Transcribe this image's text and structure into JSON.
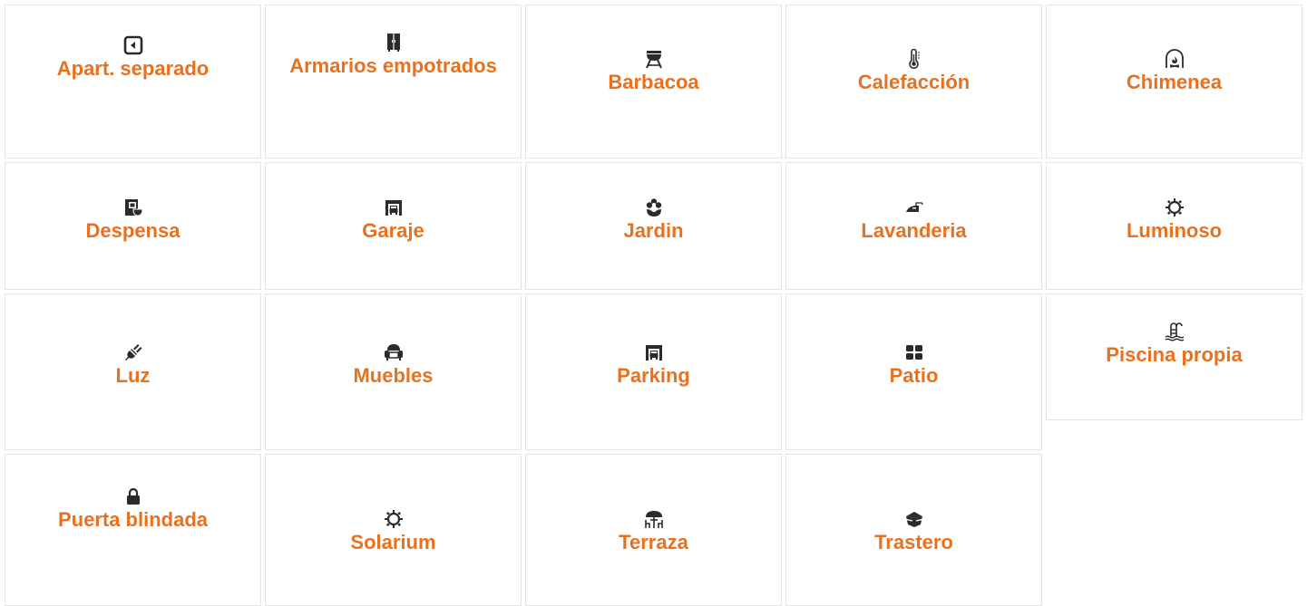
{
  "features": [
    {
      "label": "Apart. separado",
      "icon": "apartment-icon"
    },
    {
      "label": "Armarios empotrados",
      "icon": "wardrobe-icon"
    },
    {
      "label": "Barbacoa",
      "icon": "barbecue-icon"
    },
    {
      "label": "Calefacción",
      "icon": "thermometer-icon"
    },
    {
      "label": "Chimenea",
      "icon": "fireplace-icon"
    },
    {
      "label": "Despensa",
      "icon": "pantry-icon"
    },
    {
      "label": "Garaje",
      "icon": "garage-icon"
    },
    {
      "label": "Jardin",
      "icon": "flower-icon"
    },
    {
      "label": "Lavanderia",
      "icon": "iron-icon"
    },
    {
      "label": "Luminoso",
      "icon": "sun-icon"
    },
    {
      "label": "Luz",
      "icon": "plug-icon"
    },
    {
      "label": "Muebles",
      "icon": "armchair-icon"
    },
    {
      "label": "Parking",
      "icon": "garage-icon"
    },
    {
      "label": "Patio",
      "icon": "grid-squares-icon"
    },
    {
      "label": "Piscina propia",
      "icon": "pool-icon"
    },
    {
      "label": "Puerta blindada",
      "icon": "lock-icon"
    },
    {
      "label": "Solarium",
      "icon": "sun-icon"
    },
    {
      "label": "Terraza",
      "icon": "terrace-icon"
    },
    {
      "label": "Trastero",
      "icon": "box-icon"
    }
  ],
  "colors": {
    "label": "#e8711f",
    "icon": "#2b2b2b",
    "border": "#e4e4e4"
  }
}
